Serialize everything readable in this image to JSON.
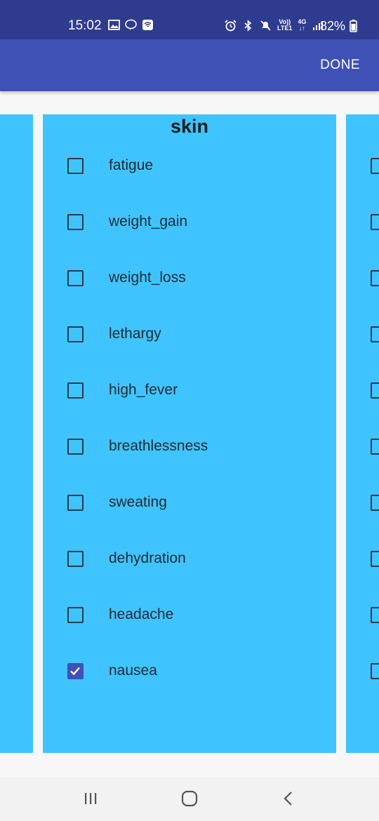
{
  "status_bar": {
    "time": "15:02",
    "battery_percent": "82%",
    "network_label_top": "Vo))",
    "network_label_bottom": "LTE1",
    "net_type": "4G",
    "left_icons": [
      "gallery-icon",
      "line-app-icon",
      "wifi-calling-icon"
    ],
    "right_icons": [
      "alarm-icon",
      "bluetooth-icon",
      "mute-icon",
      "signal-icon",
      "battery-icon"
    ]
  },
  "app_bar": {
    "done_label": "DONE",
    "color": "#3f51b5"
  },
  "card": {
    "title": "skin",
    "background": "#40c4ff",
    "items": [
      {
        "label": "fatigue",
        "checked": false
      },
      {
        "label": "weight_gain",
        "checked": false
      },
      {
        "label": "weight_loss",
        "checked": false
      },
      {
        "label": "lethargy",
        "checked": false
      },
      {
        "label": "high_fever",
        "checked": false
      },
      {
        "label": "breathlessness",
        "checked": false
      },
      {
        "label": "sweating",
        "checked": false
      },
      {
        "label": "dehydration",
        "checked": false
      },
      {
        "label": "headache",
        "checked": false
      },
      {
        "label": "nausea",
        "checked": true
      }
    ]
  },
  "nav_bar": {
    "buttons": [
      "recent-apps-icon",
      "home-icon",
      "back-icon"
    ]
  }
}
